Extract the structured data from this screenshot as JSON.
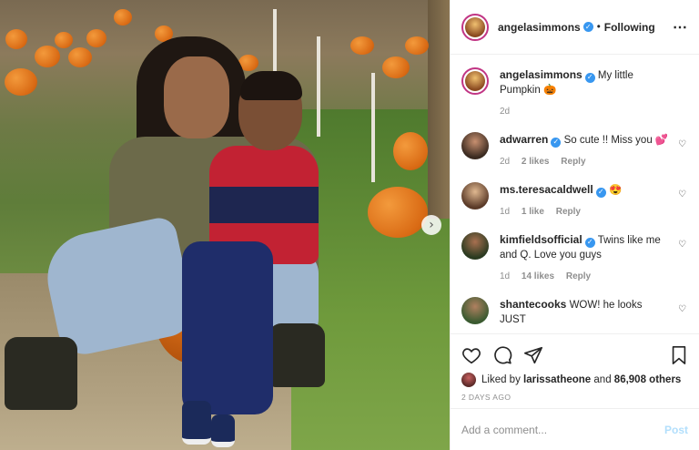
{
  "post": {
    "author": "angelasimmons",
    "follow_status": "Following",
    "separator": "•",
    "more_icon": "⋯"
  },
  "caption": {
    "username": "angelasimmons",
    "text": "My little Pumpkin",
    "emoji": "🎃",
    "age": "2d"
  },
  "comments": [
    {
      "username": "adwarren",
      "verified": true,
      "text": "So cute !! Miss you",
      "emoji": "💕",
      "age": "2d",
      "likes": "2 likes",
      "reply": "Reply"
    },
    {
      "username": "ms.teresacaldwell",
      "verified": true,
      "text": "",
      "emoji": "😍",
      "age": "1d",
      "likes": "1 like",
      "reply": "Reply"
    },
    {
      "username": "kimfieldsofficial",
      "verified": true,
      "text": "Twins like me and Q. Love you guys",
      "emoji": "",
      "age": "1d",
      "likes": "14 likes",
      "reply": "Reply"
    },
    {
      "username": "shantecooks",
      "verified": false,
      "text": "WOW! he looks JUST",
      "emoji": "",
      "age": "",
      "likes": "",
      "reply": ""
    }
  ],
  "likes": {
    "prefix": "Liked by",
    "user": "larissatheone",
    "conj": "and",
    "count": "86,908 others"
  },
  "timestamp": "2 DAYS AGO",
  "comment_box": {
    "placeholder": "Add a comment...",
    "post_label": "Post"
  },
  "icons": {
    "like": "heart-icon",
    "comment": "comment-icon",
    "share": "share-icon",
    "save": "bookmark-icon",
    "next": "chevron-right-icon"
  },
  "colors": {
    "verified": "#3897f0",
    "story_ring": "#c13584",
    "post_disabled": "#b2dffc"
  }
}
